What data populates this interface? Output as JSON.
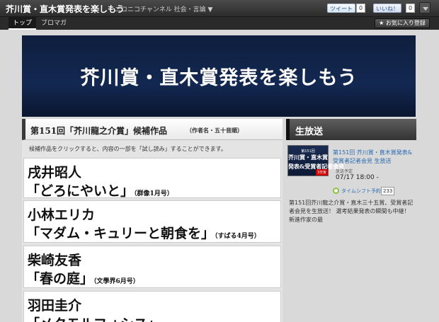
{
  "header": {
    "channel_title": "芥川賞・直木賞発表を楽しもう",
    "category": "ニコニコチャンネル 社会・言論 ▼",
    "tweet_label": "ツイート",
    "tweet_count": "0",
    "like_label": "いいね！",
    "like_count": "0",
    "menu_icon": "chevron-down-icon"
  },
  "nav": {
    "tabs": [
      {
        "label": "トップ",
        "active": true
      },
      {
        "label": "ブロマガ",
        "active": false
      }
    ],
    "favorite_label": "★ お気に入り登録"
  },
  "banner": {
    "title": "芥川賞・直木賞発表を楽しもう"
  },
  "candidates_section": {
    "title": "第151回「芥川龍之介賞」候補作品",
    "note": "（作者名・五十音順）",
    "description": "候補作品をクリックすると、内容の一部を「試し読み」することができます。",
    "items": [
      {
        "author": "戌井昭人",
        "work": "「どろにやいと」",
        "publication": "（群像1月号）"
      },
      {
        "author": "小林エリカ",
        "work": "「マダム・キュリーと朝食を」",
        "publication": "（すばる4月号）"
      },
      {
        "author": "柴崎友香",
        "work": "「春の庭」",
        "publication": "（文學界6月号）"
      },
      {
        "author": "羽田圭介",
        "work": "「メタモルフォシス」",
        "publication": ""
      }
    ]
  },
  "live_section": {
    "title": "生放送",
    "thumbnail": {
      "line1": "第151回",
      "line2": "芥川賞・直木賞",
      "line3": "発表&受賞者記者会見",
      "badge": "3日後"
    },
    "program_title": "第151回 芥川賞・直木賞発表&受賞者記者会見 生放送",
    "schedule_label": "放送予定",
    "schedule_date": "07/17 18:00 -",
    "timeshift_label": "タイムシフト予約",
    "timeshift_count": "233",
    "description": "第151回芥川龍之介賞・直木三十五賞、受賞者記者会見を生放送！ 選考結果発表の瞬間も中継！ 新進作家の最"
  }
}
